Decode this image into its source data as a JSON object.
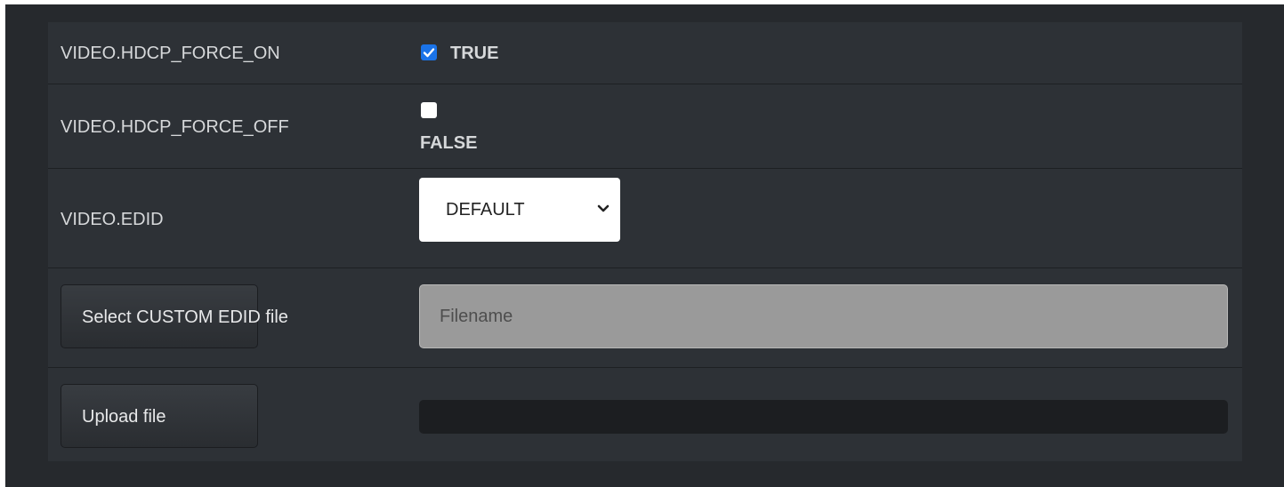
{
  "settings": {
    "hdcp_force_on": {
      "label": "VIDEO.HDCP_FORCE_ON",
      "checked": true,
      "value_text": "TRUE"
    },
    "hdcp_force_off": {
      "label": "VIDEO.HDCP_FORCE_OFF",
      "checked": false,
      "value_text": "FALSE"
    },
    "edid": {
      "label": "VIDEO.EDID",
      "selected": "DEFAULT"
    }
  },
  "custom_edid": {
    "button_label": "Select CUSTOM EDID file",
    "filename_placeholder": "Filename",
    "filename_value": ""
  },
  "upload": {
    "button_label": "Upload file",
    "progress_percent": 0
  },
  "colors": {
    "accent": "#1a73e8",
    "panel": "#2d3136",
    "background": "#26292d"
  }
}
